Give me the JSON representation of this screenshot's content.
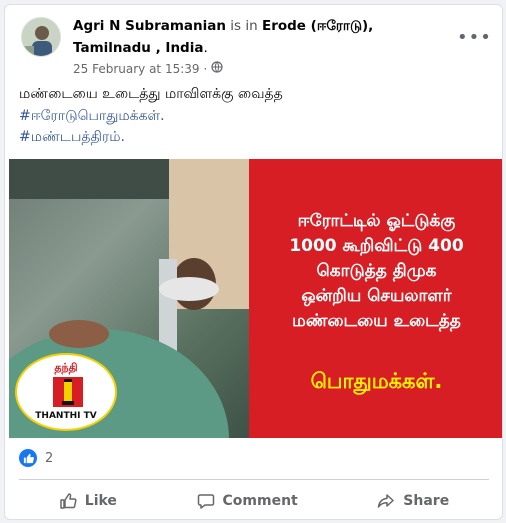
{
  "post": {
    "author": "Agri N Subramanian",
    "is_in": " is in ",
    "location": "Erode (ஈரோடு), Tamilnadu , India",
    "location_tail": ".",
    "date": "25 February at 15:39",
    "privacy_dot": "·",
    "text": "மண்டையை உடைத்து மாவிளக்கு வைத்த",
    "hashtag1": "#ஈரோடுபொதுமக்கள்.",
    "hashtag2": "#மண்டபத்திரம்.",
    "more_glyph": "•••"
  },
  "media": {
    "red_lines": [
      "ஈரோட்டில் ஓட்டுக்கு",
      "1000 கூறிவிட்டு 400",
      "கொடுத்த திமுக",
      "ஒன்றிய செயலாளர்",
      "மண்டையை உடைத்த"
    ],
    "red_bottom": "பொதுமக்கள்.",
    "logo_top": "தந்தி",
    "logo_label": "THANTHI TV"
  },
  "reactions": {
    "count": "2"
  },
  "actions": {
    "like": "Like",
    "comment": "Comment",
    "share": "Share"
  }
}
